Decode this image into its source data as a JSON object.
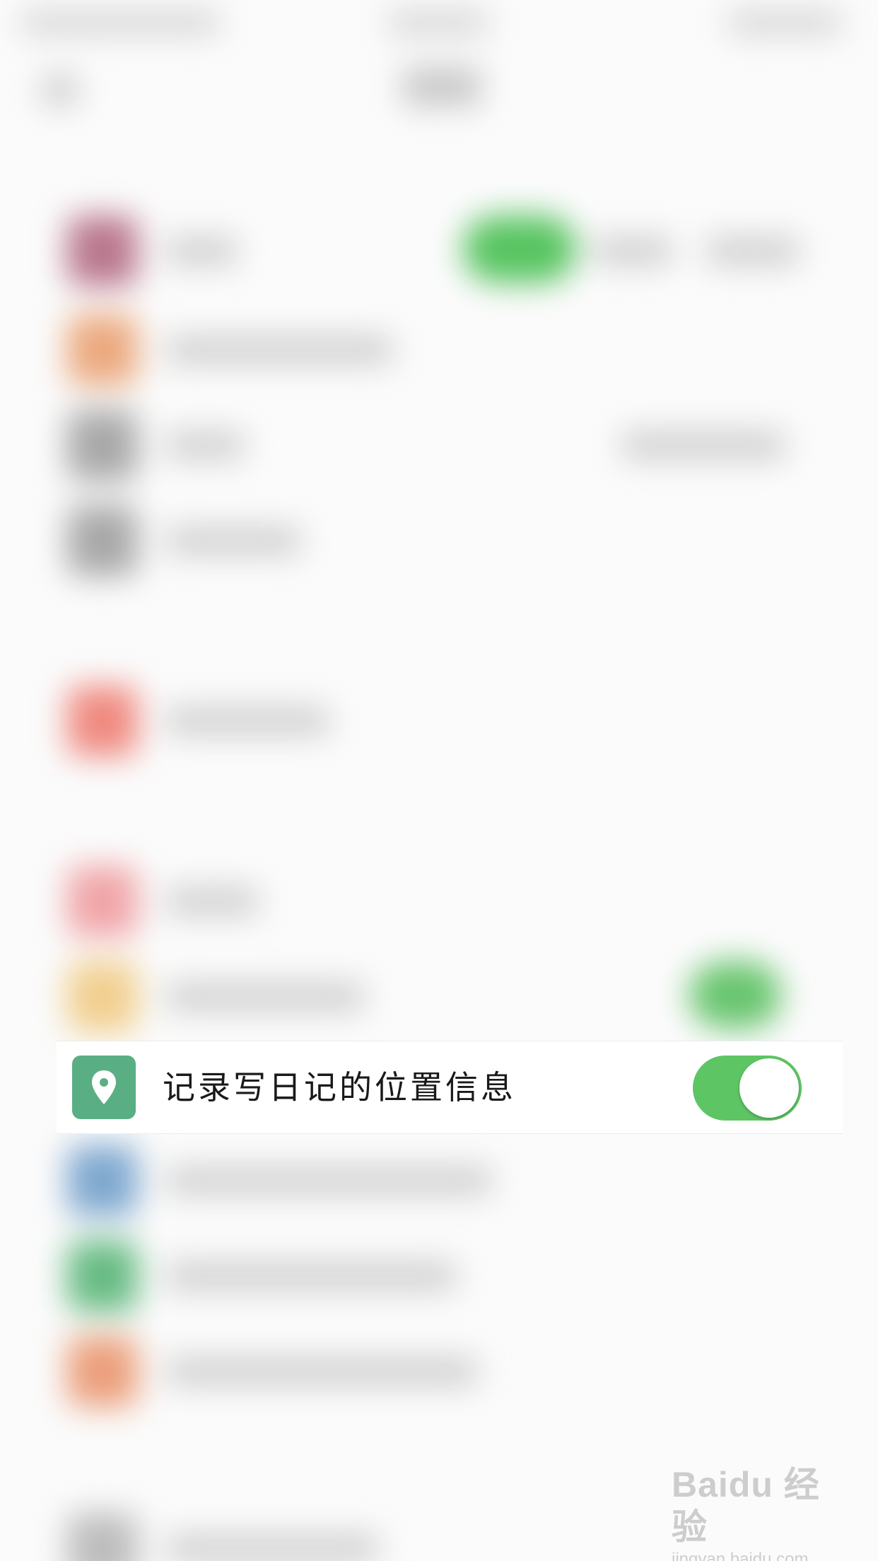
{
  "location_row": {
    "label": "记录写日记的位置信息",
    "icon": "location-pin-icon",
    "icon_color": "#5aae84",
    "toggle_on": true,
    "toggle_color": "#5dc564"
  },
  "watermark": {
    "logo_text": "Baidu 经验",
    "url": "jingyan.baidu.com"
  }
}
